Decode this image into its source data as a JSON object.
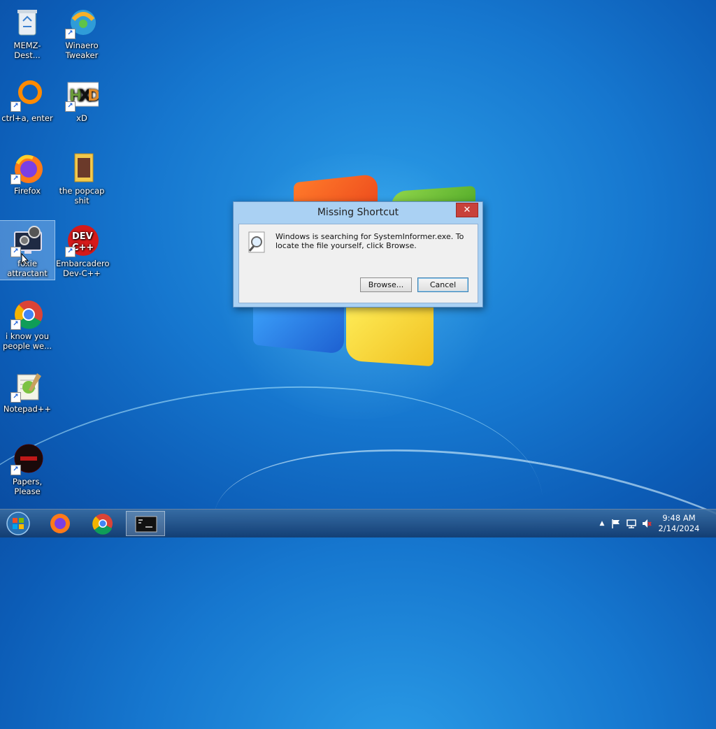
{
  "desktop": {
    "icons": [
      {
        "label": "MEMZ-Dest..."
      },
      {
        "label": "Winaero Tweaker"
      },
      {
        "label": "ctrl+a, enter"
      },
      {
        "label": "xD"
      },
      {
        "label": "Firefox"
      },
      {
        "label": "the popcap shit"
      },
      {
        "label": "foxie attractant"
      },
      {
        "label": "Embarcadero Dev-C++"
      },
      {
        "label": "i know you people we..."
      },
      {
        "label": "Notepad++"
      },
      {
        "label": "Papers, Please"
      }
    ]
  },
  "dialog": {
    "title": "Missing Shortcut",
    "close_label": "✕",
    "message": "Windows is searching for SystemInformer.exe. To locate the file yourself, click Browse.",
    "browse_label": "Browse...",
    "cancel_label": "Cancel"
  },
  "taskbar": {
    "pinned": [
      "start-button",
      "firefox",
      "chrome",
      "command-prompt"
    ],
    "time": "9:48 AM",
    "date": "2/14/2024"
  }
}
